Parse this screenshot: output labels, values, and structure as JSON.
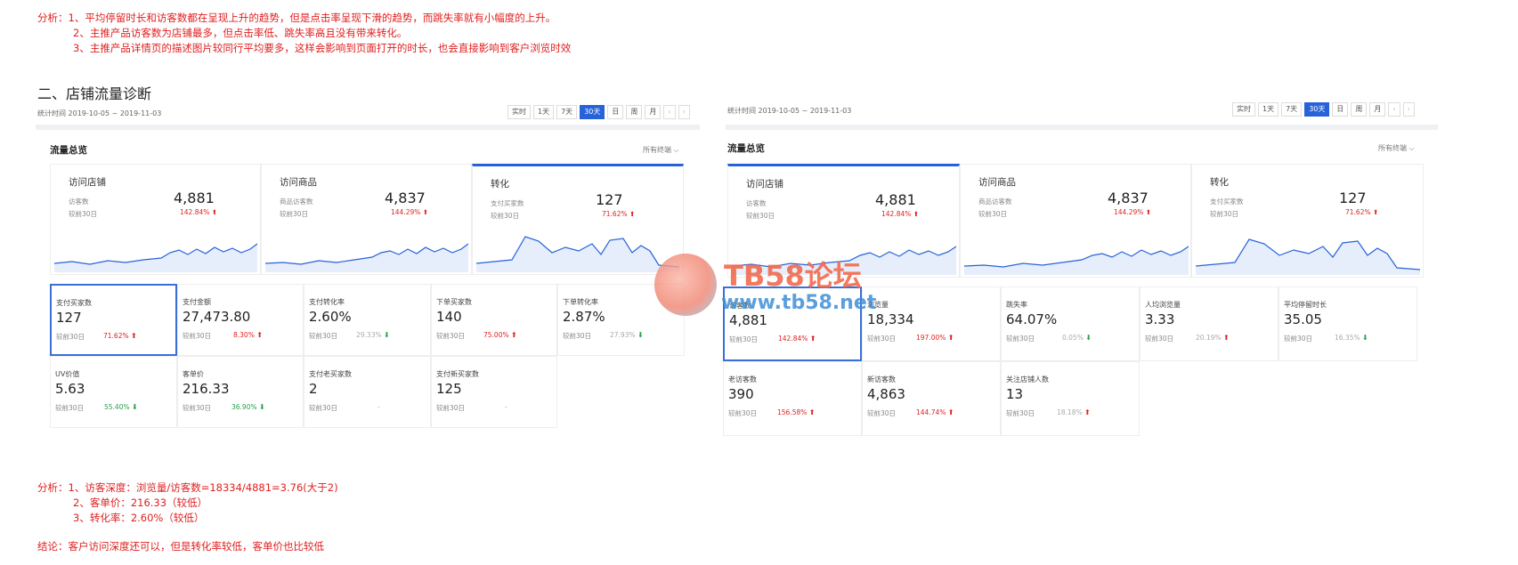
{
  "analysis_top": {
    "prefix": "分析：",
    "lines": [
      "1、平均停留时长和访客数都在呈现上升的趋势，但是点击率呈现下滑的趋势，而跳失率就有小幅度的上升。",
      "2、主推产品访客数为店铺最多，但点击率低、跳失率高且没有带来转化。",
      "3、主推产品详情页的描述图片较同行平均要多，这样会影响到页面打开的时长，也会直接影响到客户浏览时效"
    ]
  },
  "section_title": "二、店铺流量诊断",
  "left_panel": {
    "stat_time": "统计时间 2019-10-05 ~ 2019-11-03",
    "ranges": [
      "实时",
      "1天",
      "7天",
      "30天",
      "日",
      "周",
      "月",
      "‹",
      "›"
    ],
    "active_range": "30天",
    "title": "流量总览",
    "filter": "所有终端 ⌵",
    "cards": [
      {
        "title": "访问店铺",
        "label": "访客数",
        "compare": "较前30日",
        "value": "4,881",
        "pct": "142.84% ⬆"
      },
      {
        "title": "访问商品",
        "label": "商品访客数",
        "compare": "较前30日",
        "value": "4,837",
        "pct": "144.29% ⬆"
      },
      {
        "title": "转化",
        "label": "支付买家数",
        "compare": "较前30日",
        "value": "127",
        "pct": "71.62% ⬆"
      }
    ],
    "metrics": [
      {
        "label": "支付买家数",
        "value": "127",
        "compare": "较前30日",
        "pct": "71.62%",
        "dir": "up"
      },
      {
        "label": "支付金额",
        "value": "27,473.80",
        "compare": "较前30日",
        "pct": "8.30%",
        "dir": "up"
      },
      {
        "label": "支付转化率",
        "value": "2.60%",
        "compare": "较前30日",
        "pct": "29.33%",
        "dir": "down"
      },
      {
        "label": "下单买家数",
        "value": "140",
        "compare": "较前30日",
        "pct": "75.00%",
        "dir": "up"
      },
      {
        "label": "下单转化率",
        "value": "2.87%",
        "compare": "较前30日",
        "pct": "27.93%",
        "dir": "down"
      },
      {
        "label": "UV价值",
        "value": "5.63",
        "compare": "较前30日",
        "pct": "55.40%",
        "dir": "down"
      },
      {
        "label": "客单价",
        "value": "216.33",
        "compare": "较前30日",
        "pct": "36.90%",
        "dir": "down"
      },
      {
        "label": "支付老买家数",
        "value": "2",
        "compare": "较前30日",
        "pct": "-",
        "dir": "none"
      },
      {
        "label": "支付新买家数",
        "value": "125",
        "compare": "较前30日",
        "pct": "-",
        "dir": "none"
      }
    ]
  },
  "right_panel": {
    "stat_time": "统计时间 2019-10-05 ~ 2019-11-03",
    "ranges": [
      "实时",
      "1天",
      "7天",
      "30天",
      "日",
      "周",
      "月",
      "‹",
      "›"
    ],
    "active_range": "30天",
    "title": "流量总览",
    "filter": "所有终端 ⌵",
    "cards": [
      {
        "title": "访问店铺",
        "label": "访客数",
        "compare": "较前30日",
        "value": "4,881",
        "pct": "142.84% ⬆"
      },
      {
        "title": "访问商品",
        "label": "商品访客数",
        "compare": "较前30日",
        "value": "4,837",
        "pct": "144.29% ⬆"
      },
      {
        "title": "转化",
        "label": "支付买家数",
        "compare": "较前30日",
        "value": "127",
        "pct": "71.62% ⬆"
      }
    ],
    "metrics": [
      {
        "label": "访客数",
        "value": "4,881",
        "compare": "较前30日",
        "pct": "142.84%",
        "dir": "up"
      },
      {
        "label": "浏览量",
        "value": "18,334",
        "compare": "较前30日",
        "pct": "197.00%",
        "dir": "up"
      },
      {
        "label": "跳失率",
        "value": "64.07%",
        "compare": "较前30日",
        "pct": "0.05%",
        "dir": "down"
      },
      {
        "label": "人均浏览量",
        "value": "3.33",
        "compare": "较前30日",
        "pct": "20.19%",
        "dir": "up"
      },
      {
        "label": "平均停留时长",
        "value": "35.05",
        "compare": "较前30日",
        "pct": "16.35%",
        "dir": "down"
      },
      {
        "label": "老访客数",
        "value": "390",
        "compare": "较前30日",
        "pct": "156.58%",
        "dir": "up"
      },
      {
        "label": "新访客数",
        "value": "4,863",
        "compare": "较前30日",
        "pct": "144.74%",
        "dir": "up"
      },
      {
        "label": "关注店铺人数",
        "value": "13",
        "compare": "较前30日",
        "pct": "18.18%",
        "dir": "up"
      }
    ]
  },
  "watermark": {
    "title": "TB58论坛",
    "url": "www.tb58.net"
  },
  "analysis_bottom": {
    "prefix": "分析：",
    "lines": [
      "1、访客深度：浏览量/访客数=18334/4881=3.76(大于2)",
      "2、客单价：216.33（较低）",
      "3、转化率：2.60%（较低）"
    ]
  },
  "conclusion": "结论：客户访问深度还可以，但是转化率较低，客单价也比较低",
  "colors": {
    "accent": "#2862d9",
    "up": "#e02020",
    "down": "#2a9d4b",
    "note": "#e02020"
  }
}
